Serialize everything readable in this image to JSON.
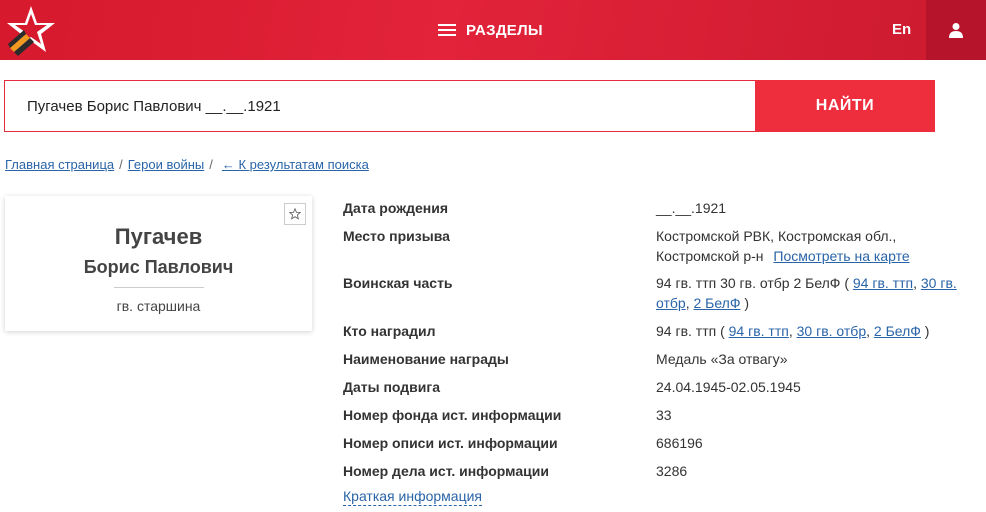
{
  "header": {
    "menu_label": "РАЗДЕЛЫ",
    "lang_label": "En",
    "brand_color": "#d6192c"
  },
  "search": {
    "value": "Пугачев Борис Павлович __.__.1921",
    "button_label": "НАЙТИ"
  },
  "breadcrumb": {
    "home": "Главная страница",
    "heroes": "Герои войны",
    "back": "← К результатам поиска",
    "separator": "/"
  },
  "person": {
    "surname": "Пугачев",
    "given_names": "Борис Павлович",
    "rank": "гв. старшина"
  },
  "details": {
    "birth_date": {
      "label": "Дата рождения",
      "value": "__.__.1921"
    },
    "draft_place": {
      "label": "Место призыва",
      "value": "Костромской РВК, Костромская обл., Костромской р-н",
      "map_link": "Посмотреть на карте"
    },
    "unit": {
      "label": "Воинская часть",
      "value_prefix": "94 гв. ттп 30 гв. отбр 2 БелФ (",
      "link1": "94 гв. ттп",
      "comma1": ",",
      "link2": "30 гв. отбр",
      "comma2": ",",
      "link3": "2 БелФ",
      "value_suffix": ")"
    },
    "awarded_by": {
      "label": "Кто наградил",
      "value_prefix": "94 гв. ттп (",
      "link1": "94 гв. ттп",
      "comma1": ",",
      "link2": "30 гв. отбр",
      "comma2": ",",
      "link3": "2 БелФ",
      "value_suffix": ")"
    },
    "award_name": {
      "label": "Наименование награды",
      "value": "Медаль «За отвагу»"
    },
    "feat_dates": {
      "label": "Даты подвига",
      "value": "24.04.1945-02.05.1945"
    },
    "fund_number": {
      "label": "Номер фонда ист. информации",
      "value": "33"
    },
    "inventory_number": {
      "label": "Номер описи ист. информации",
      "value": "686196"
    },
    "case_number": {
      "label": "Номер дела ист. информации",
      "value": "3286"
    }
  },
  "short_info_link": "Краткая информация"
}
